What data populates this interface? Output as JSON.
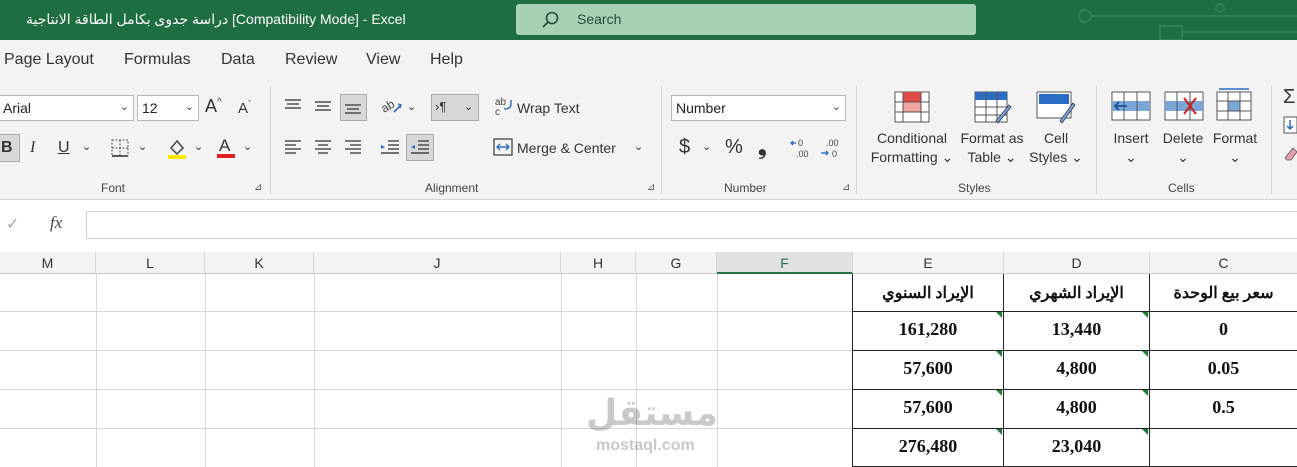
{
  "window": {
    "title": "دراسة جدوى بكامل الطاقة الانتاجية  [Compatibility Mode]  -  Excel",
    "search_placeholder": "Search"
  },
  "menu": [
    "Page Layout",
    "Formulas",
    "Data",
    "Review",
    "View",
    "Help"
  ],
  "ribbon": {
    "font": {
      "font_name": "Arial",
      "font_size": "12",
      "group_label": "Font",
      "bold": "B",
      "italic": "I",
      "underline": "U",
      "grow": "A",
      "shrink": "A"
    },
    "alignment": {
      "wrap_text": "Wrap Text",
      "merge_center": "Merge & Center",
      "group_label": "Alignment"
    },
    "number": {
      "format": "Number",
      "currency": "$",
      "percent": "%",
      "comma": "❟",
      "group_label": "Number"
    },
    "styles": {
      "conditional_1": "Conditional",
      "conditional_2": "Formatting",
      "format_table_1": "Format as",
      "format_table_2": "Table",
      "cell_styles_1": "Cell",
      "cell_styles_2": "Styles",
      "group_label": "Styles"
    },
    "cells": {
      "insert": "Insert",
      "delete": "Delete",
      "format": "Format",
      "group_label": "Cells"
    }
  },
  "formula_bar": {
    "fx": "fx",
    "value": ""
  },
  "columns": [
    "M",
    "L",
    "K",
    "J",
    "H",
    "G",
    "F",
    "E",
    "D",
    "C"
  ],
  "table": {
    "headers": {
      "E": "الإيراد السنوي",
      "D": "الإيراد الشهري",
      "C": "سعر بيع الوحدة"
    },
    "rows": [
      {
        "E": "161,280",
        "D": "13,440",
        "C": "0"
      },
      {
        "E": "57,600",
        "D": "4,800",
        "C": "0.05"
      },
      {
        "E": "57,600",
        "D": "4,800",
        "C": "0.5"
      },
      {
        "E": "276,480",
        "D": "23,040",
        "C": ""
      }
    ]
  },
  "watermark": {
    "arabic": "مستقل",
    "latin": "mostaql.com"
  },
  "colors": {
    "title_bar": "#1e6e41",
    "accent": "#217346"
  }
}
